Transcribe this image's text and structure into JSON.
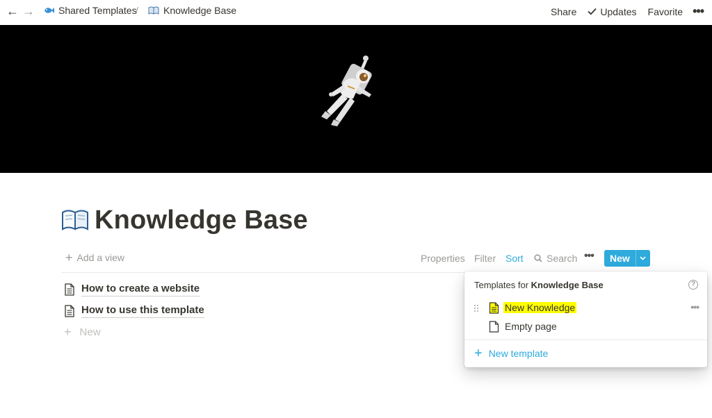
{
  "topbar": {
    "back_arrow": "←",
    "forward_arrow": "→",
    "breadcrumb": [
      {
        "icon": "fish-icon",
        "label": "Shared Templates"
      },
      {
        "icon": "open-book-icon",
        "label": "Knowledge Base"
      }
    ],
    "separator": "/",
    "share_label": "Share",
    "updates_label": "Updates",
    "favorite_label": "Favorite",
    "more_label": "•••"
  },
  "cover": {
    "image": "astronaut-floating-in-space"
  },
  "page": {
    "icon": "open-book-icon",
    "title": "Knowledge Base"
  },
  "viewbar": {
    "add_view": "Add a view",
    "properties": "Properties",
    "filter": "Filter",
    "sort": "Sort",
    "search": "Search",
    "more": "•••",
    "new_button": "New",
    "accent_color": "#2eaadc"
  },
  "list": {
    "items": [
      {
        "title": "How to create a website"
      },
      {
        "title": "How to use this template"
      }
    ],
    "new_label": "New"
  },
  "templates_popup": {
    "heading_prefix": "Templates for ",
    "heading_db": "Knowledge Base",
    "help": "?",
    "templates": [
      {
        "label": "New Knowledge",
        "highlight": "#ffff00"
      },
      {
        "label": "Empty page"
      }
    ],
    "more": "•••",
    "new_template": "New template"
  }
}
